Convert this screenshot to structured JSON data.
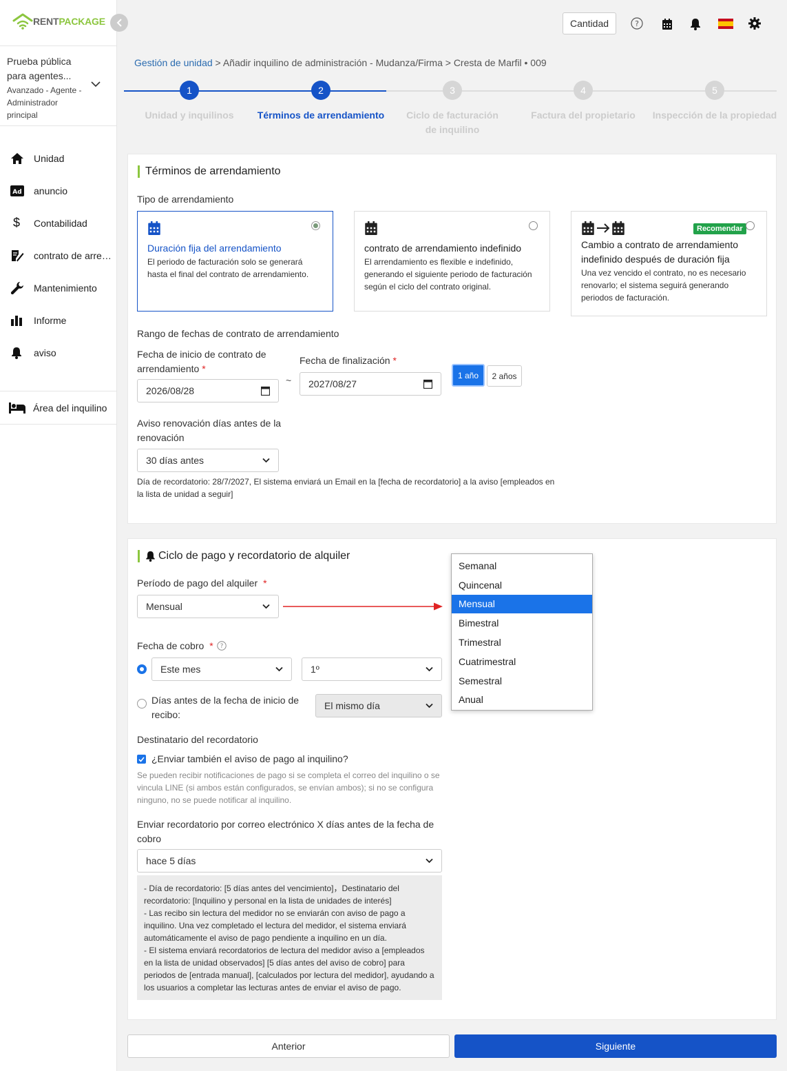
{
  "brand": {
    "rent": "RENT",
    "package": "PACKAGE",
    "accent": "#8cc63f"
  },
  "account": {
    "name": "Prueba pública para agentes...",
    "role": "Avanzado - Agente - Administrador principal"
  },
  "nav": [
    {
      "label": "Unidad",
      "icon": "home-icon"
    },
    {
      "label": "anuncio",
      "icon": "ad-icon"
    },
    {
      "label": "Contabilidad",
      "icon": "dollar-icon"
    },
    {
      "label": "contrato de arrendamiento",
      "icon": "contract-icon"
    },
    {
      "label": "Mantenimiento",
      "icon": "wrench-icon"
    },
    {
      "label": "Informe",
      "icon": "chart-icon"
    },
    {
      "label": "aviso",
      "icon": "bell-icon"
    }
  ],
  "tenant_area": "Área del inquilino",
  "header": {
    "quantity": "Cantidad"
  },
  "breadcrumb": {
    "link": "Gestión de unidad",
    "rest": " > Añadir inquilino de administración - Mudanza/Firma > Cresta de Marfil • 009"
  },
  "steps": [
    {
      "num": "1",
      "label": "Unidad y inquilinos"
    },
    {
      "num": "2",
      "label": "Términos de arrendamiento"
    },
    {
      "num": "3",
      "label": "Ciclo de facturación de inquilino"
    },
    {
      "num": "4",
      "label": "Factura del propietario"
    },
    {
      "num": "5",
      "label": "Inspección de la propiedad"
    }
  ],
  "lease": {
    "title": "Términos de arrendamiento",
    "type_label": "Tipo de arrendamiento",
    "types": [
      {
        "title": "Duración fija del arrendamiento",
        "desc": "El periodo de facturación solo se generará hasta el final del contrato de arrendamiento."
      },
      {
        "title": "contrato de arrendamiento indefinido",
        "desc": "El arrendamiento es flexible e indefinido, generando el siguiente periodo de facturación según el ciclo del contrato original."
      },
      {
        "title": "Cambio a contrato de arrendamiento indefinido después de duración fija",
        "desc": "Una vez vencido el contrato, no es necesario renovarlo; el sistema seguirá generando periodos de facturación.",
        "badge": "Recomendar"
      }
    ],
    "range_label": "Rango de fechas de contrato de arrendamiento",
    "start_label": "Fecha de inicio de contrato de arrendamiento",
    "start_value": "2026/08/28",
    "end_label": "Fecha de finalización",
    "end_value": "2027/08/27",
    "tilde": "~",
    "btn_1y": "1 año",
    "btn_2y": "2 años",
    "renew_label": "Aviso renovación días antes de la renovación",
    "renew_value": "30 días antes",
    "renew_note": "Día de recordatorio: 28/7/2027, El sistema enviará un Email en la [fecha de recordatorio] a la aviso [empleados en la lista de unidad a seguir]"
  },
  "payment": {
    "title": "Ciclo de pago y recordatorio de alquiler",
    "period_label": "Período de pago del alquiler",
    "period_value": "Mensual",
    "period_options": [
      "Semanal",
      "Quincenal",
      "Mensual",
      "Bimestral",
      "Trimestral",
      "Cuatrimestral",
      "Semestral",
      "Anual"
    ],
    "period_selected_index": 2,
    "collect_label": "Fecha de cobro",
    "collect_month": "Este mes",
    "collect_day": "1º",
    "days_before_label": "Días antes de la fecha de inicio de recibo:",
    "days_before_value": "El mismo día",
    "recipient_label": "Destinatario del recordatorio",
    "send_tenant": "¿Enviar también el aviso de pago al inquilino?",
    "send_note": "Se pueden recibir notificaciones de pago si se completa el correo del inquilino o se vincula LINE (si ambos están configurados, se envían ambos); si no se configura ninguno, no se puede notificar al inquilino.",
    "email_label": "Enviar recordatorio por correo electrónico X días antes de la fecha de cobro",
    "email_value": "hace 5 días",
    "info": [
      "- Día de recordatorio: [5 días antes del vencimiento]，Destinatario del recordatorio: [Inquilino y personal en la lista de unidades de interés]",
      "- Las recibo sin lectura del medidor no se enviarán con aviso de pago a inquilino. Una vez completado el lectura del medidor, el sistema enviará automáticamente el aviso de pago pendiente a inquilino en un día.",
      "- El sistema enviará recordatorios de lectura del medidor aviso a [empleados en la lista de unidad observados] [5 días antes del aviso de cobro] para periodos de [entrada manual], [calculados por lectura del medidor], ayudando a los usuarios a completar las lecturas antes de enviar el aviso de pago."
    ]
  },
  "footer": {
    "prev": "Anterior",
    "next": "Siguiente"
  },
  "colors": {
    "primary": "#1553c7",
    "required": "#e02424"
  }
}
